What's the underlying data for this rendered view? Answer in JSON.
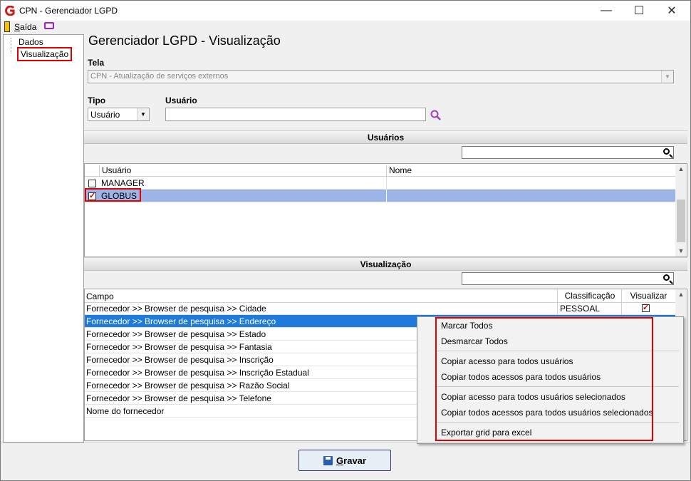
{
  "window": {
    "title": "CPN - Gerenciador LGPD",
    "minimize": "—",
    "maximize": "☐",
    "close": "✕"
  },
  "menu": {
    "saida_prefix": "S",
    "saida_rest": "aída"
  },
  "tree": {
    "items": [
      {
        "label": "Dados"
      },
      {
        "label": "Visualização"
      }
    ]
  },
  "main": {
    "title": "Gerenciador LGPD - Visualização",
    "tela_label": "Tela",
    "tela_value": "CPN - Atualização de serviços externos",
    "tipo_label": "Tipo",
    "tipo_value": "Usuário",
    "usuario_label": "Usuário",
    "usuario_value": ""
  },
  "usuarios": {
    "header": "Usuários",
    "search_value": "",
    "columns": [
      "Usuário",
      "Nome"
    ],
    "rows": [
      {
        "checked": false,
        "usuario": "MANAGER",
        "nome": ""
      },
      {
        "checked": true,
        "usuario": "GLOBUS",
        "nome": ""
      }
    ]
  },
  "visualizacao": {
    "header": "Visualização",
    "search_value": "",
    "columns": [
      "Campo",
      "Classificação",
      "Visualizar"
    ],
    "rows": [
      {
        "campo": "Fornecedor >> Browser de pesquisa >> Cidade",
        "classificacao": "PESSOAL",
        "visualizar": true
      },
      {
        "campo": "Fornecedor >> Browser de pesquisa >> Endereço"
      },
      {
        "campo": "Fornecedor >> Browser de pesquisa >> Estado"
      },
      {
        "campo": "Fornecedor >> Browser de pesquisa >> Fantasia"
      },
      {
        "campo": "Fornecedor >> Browser de pesquisa >> Inscrição"
      },
      {
        "campo": "Fornecedor >> Browser de pesquisa >> Inscrição Estadual"
      },
      {
        "campo": "Fornecedor >> Browser de pesquisa >> Razão Social"
      },
      {
        "campo": "Fornecedor >> Browser de pesquisa >> Telefone"
      },
      {
        "campo": "Nome do fornecedor"
      }
    ]
  },
  "context_menu": {
    "items": [
      "Marcar Todos",
      "Desmarcar Todos",
      "Copiar acesso para todos usuários",
      "Copiar todos acessos para todos usuários",
      "Copiar acesso para todos usuários selecionados",
      "Copiar todos acessos para todos usuários selecionados",
      "Exportar grid para excel"
    ]
  },
  "footer": {
    "gravar_prefix": "G",
    "gravar_rest": "ravar"
  },
  "colors": {
    "highlight_red": "#e00000",
    "selection_blue": "#1e7bd9",
    "row_selected": "#9cb4e6"
  }
}
